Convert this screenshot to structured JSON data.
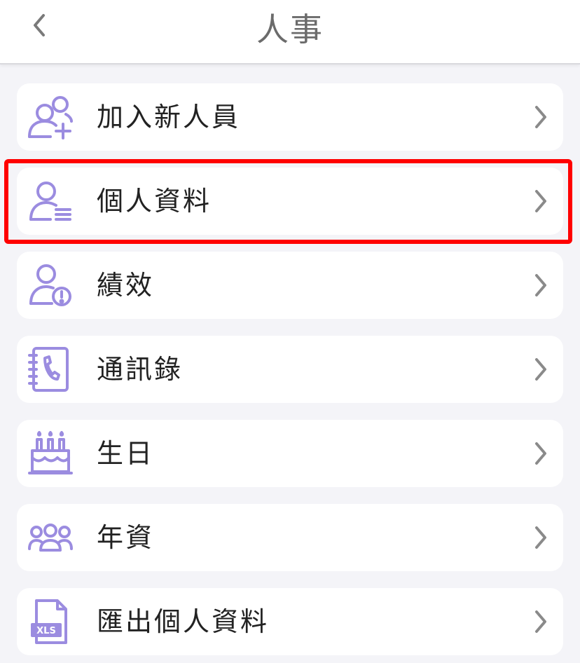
{
  "header": {
    "title": "人事"
  },
  "accent_color": "#9b8ce0",
  "items": [
    {
      "label": "加入新人員",
      "icon": "add-person-icon"
    },
    {
      "label": "個人資料",
      "icon": "person-list-icon"
    },
    {
      "label": "績效",
      "icon": "person-alert-icon"
    },
    {
      "label": "通訊錄",
      "icon": "phonebook-icon"
    },
    {
      "label": "生日",
      "icon": "birthday-cake-icon"
    },
    {
      "label": "年資",
      "icon": "group-icon"
    },
    {
      "label": "匯出個人資料",
      "icon": "xls-file-icon",
      "icon_text": "XLS"
    }
  ]
}
